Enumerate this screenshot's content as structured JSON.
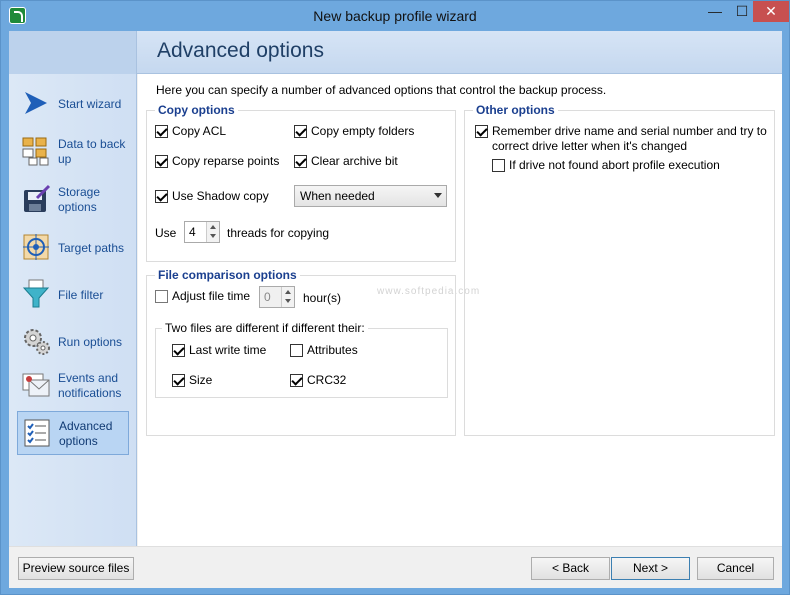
{
  "window": {
    "title": "New backup profile wizard",
    "min_glyph": "—",
    "max_glyph": "☐",
    "close_glyph": "✕"
  },
  "banner": {
    "title": "Advanced options"
  },
  "sidebar": {
    "items": [
      {
        "label": "Start wizard",
        "icon": "arrow-icon",
        "active": false
      },
      {
        "label": "Data to back up",
        "icon": "files-icon",
        "active": false
      },
      {
        "label": "Storage options",
        "icon": "disk-icon",
        "active": false
      },
      {
        "label": "Target paths",
        "icon": "target-icon",
        "active": false
      },
      {
        "label": "File filter",
        "icon": "funnel-icon",
        "active": false
      },
      {
        "label": "Run options",
        "icon": "gears-icon",
        "active": false
      },
      {
        "label": "Events and notifications",
        "icon": "mail-icon",
        "active": false
      },
      {
        "label": "Advanced options",
        "icon": "checklist-icon",
        "active": true
      }
    ]
  },
  "intro": "Here you can specify a number of advanced options that control the backup process.",
  "copy_options": {
    "title": "Copy options",
    "copy_acl": {
      "label": "Copy ACL",
      "checked": true
    },
    "copy_empty_folders": {
      "label": "Copy empty folders",
      "checked": true
    },
    "copy_reparse_points": {
      "label": "Copy reparse points",
      "checked": true
    },
    "clear_archive_bit": {
      "label": "Clear archive bit",
      "checked": true
    },
    "use_shadow_copy": {
      "label": "Use Shadow copy",
      "checked": true
    },
    "shadow_mode": "When needed",
    "use_label": "Use",
    "threads": "4",
    "threads_label": "threads for copying"
  },
  "file_comparison": {
    "title": "File comparison options",
    "adjust_time": {
      "label": "Adjust file time",
      "checked": false
    },
    "hours": "0",
    "hours_label": "hour(s)",
    "sub_title": "Two files are different if different their:",
    "last_write_time": {
      "label": "Last write time",
      "checked": true
    },
    "attributes": {
      "label": "Attributes",
      "checked": false
    },
    "size": {
      "label": "Size",
      "checked": true
    },
    "crc32": {
      "label": "CRC32",
      "checked": true
    }
  },
  "other_options": {
    "title": "Other options",
    "remember_drive": {
      "label_line1": "Remember drive name and serial number and try to",
      "label_line2": "correct drive letter when it's changed",
      "checked": true
    },
    "abort_if_not_found": {
      "label": "If drive not found abort profile execution",
      "checked": false
    }
  },
  "watermark": "www.softpedia.com",
  "footer": {
    "preview": "Preview source files",
    "back": "< Back",
    "next": "Next >",
    "cancel": "Cancel"
  }
}
